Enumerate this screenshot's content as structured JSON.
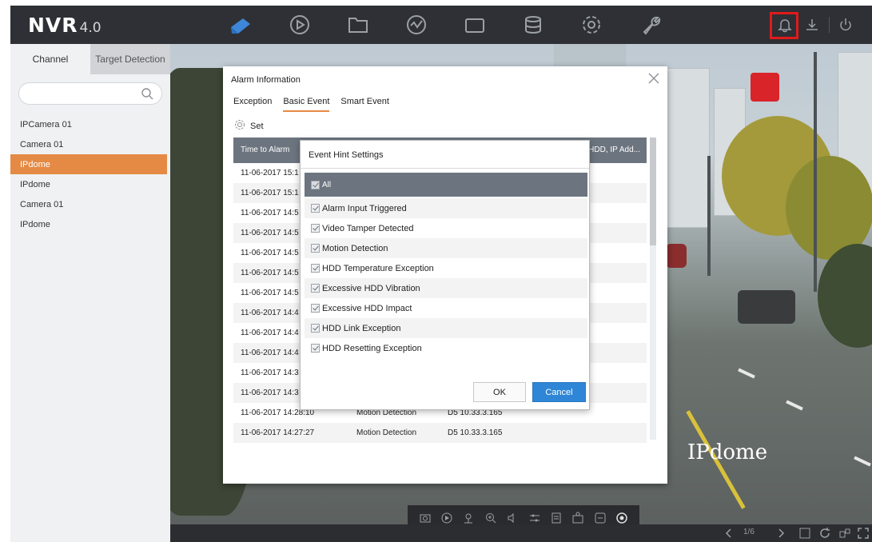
{
  "logo": {
    "main": "NVR",
    "version": "4.0"
  },
  "sidebar": {
    "tabs": [
      "Channel",
      "Target Detection"
    ],
    "search_placeholder": "",
    "items": [
      {
        "label": "IPCamera 01",
        "selected": false
      },
      {
        "label": "Camera 01",
        "selected": false
      },
      {
        "label": "IPdome",
        "selected": true
      },
      {
        "label": "IPdome",
        "selected": false
      },
      {
        "label": "Camera 01",
        "selected": false
      },
      {
        "label": "IPdome",
        "selected": false
      }
    ]
  },
  "camera": {
    "name": "IPdome",
    "page": "1/6"
  },
  "alarm_dialog": {
    "title": "Alarm Information",
    "tabs": [
      "Exception",
      "Basic Event",
      "Smart Event"
    ],
    "active_tab": "Basic Event",
    "set_label": "Set",
    "columns": {
      "time": "Time to Alarm",
      "source": "., HDD, IP Add..."
    },
    "rows": [
      {
        "time": "11-06-2017 15:1",
        "event": "",
        "source": ""
      },
      {
        "time": "11-06-2017 15:1",
        "event": "",
        "source": ""
      },
      {
        "time": "11-06-2017 14:5",
        "event": "",
        "source": ""
      },
      {
        "time": "11-06-2017 14:5",
        "event": "",
        "source": ""
      },
      {
        "time": "11-06-2017 14:5",
        "event": "",
        "source": ""
      },
      {
        "time": "11-06-2017 14:5",
        "event": "",
        "source": ""
      },
      {
        "time": "11-06-2017 14:5",
        "event": "",
        "source": ""
      },
      {
        "time": "11-06-2017 14:4",
        "event": "",
        "source": ""
      },
      {
        "time": "11-06-2017 14:4",
        "event": "",
        "source": ""
      },
      {
        "time": "11-06-2017 14:4",
        "event": "",
        "source": ""
      },
      {
        "time": "11-06-2017 14:3",
        "event": "",
        "source": ""
      },
      {
        "time": "11-06-2017 14:3",
        "event": "",
        "source": ""
      },
      {
        "time": "11-06-2017 14:28:10",
        "event": "Motion Detection",
        "source": "D5  10.33.3.165"
      },
      {
        "time": "11-06-2017 14:27:27",
        "event": "Motion Detection",
        "source": "D5  10.33.3.165"
      }
    ]
  },
  "hint_dialog": {
    "title": "Event Hint Settings",
    "all_label": "All",
    "items": [
      "Alarm Input Triggered",
      "Video Tamper Detected",
      "Motion Detection",
      "HDD Temperature Exception",
      "Excessive HDD Vibration",
      "Excessive HDD Impact",
      "HDD Link Exception",
      "HDD Resetting Exception"
    ],
    "ok_label": "OK",
    "cancel_label": "Cancel"
  },
  "colors": {
    "accent": "#e58a44",
    "primary_button": "#2f86d6",
    "alarm_highlight": "#e21a1a",
    "header": "#6c757f"
  }
}
